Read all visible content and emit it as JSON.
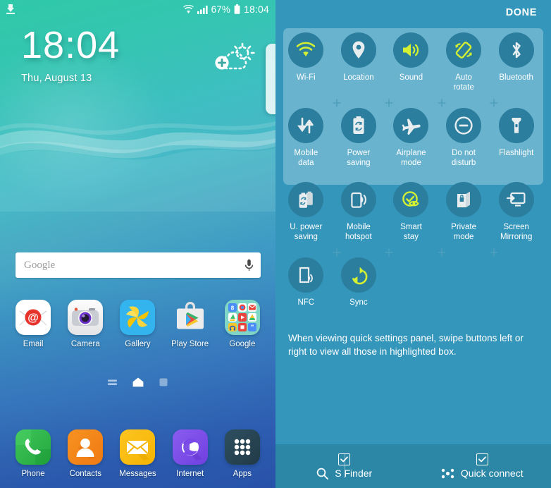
{
  "home": {
    "status_bar": {
      "download_icon": "download-icon",
      "wifi_icon": "wifi-icon",
      "signal_icon": "signal-bars-icon",
      "battery_percent": "67%",
      "battery_icon": "battery-icon",
      "clock": "18:04"
    },
    "clock_widget": {
      "time": "18:04",
      "date": "Thu, August 13",
      "weather_icon": "add-weather-icon"
    },
    "search": {
      "placeholder": "Google",
      "mic_icon": "microphone-icon"
    },
    "apps": [
      {
        "label": "Email",
        "icon": "email-icon"
      },
      {
        "label": "Camera",
        "icon": "camera-icon"
      },
      {
        "label": "Gallery",
        "icon": "gallery-icon"
      },
      {
        "label": "Play Store",
        "icon": "play-store-icon"
      },
      {
        "label": "Google",
        "icon": "google-folder-icon"
      }
    ],
    "page_indicator": [
      {
        "name": "briefing-page-icon",
        "active": false
      },
      {
        "name": "home-page-icon",
        "active": true
      },
      {
        "name": "page-dot-icon",
        "active": false
      }
    ],
    "dock": [
      {
        "label": "Phone",
        "icon": "phone-icon"
      },
      {
        "label": "Contacts",
        "icon": "contacts-icon"
      },
      {
        "label": "Messages",
        "icon": "messages-icon"
      },
      {
        "label": "Internet",
        "icon": "internet-icon"
      },
      {
        "label": "Apps",
        "icon": "apps-grid-icon"
      }
    ]
  },
  "quick_settings": {
    "done_label": "DONE",
    "note": "When viewing quick settings panel, swipe buttons left or right to view all those in highlighted box.",
    "plus_label": "+",
    "rows": [
      {
        "in_highlight": true,
        "buttons": [
          {
            "label": "Wi-Fi",
            "icon": "wifi-icon",
            "active": true
          },
          {
            "label": "Location",
            "icon": "location-pin-icon",
            "active": false
          },
          {
            "label": "Sound",
            "icon": "sound-speaker-icon",
            "active": true
          },
          {
            "label": "Auto\nrotate",
            "icon": "auto-rotate-icon",
            "active": true
          },
          {
            "label": "Bluetooth",
            "icon": "bluetooth-icon",
            "active": false
          }
        ]
      },
      {
        "in_highlight": true,
        "buttons": [
          {
            "label": "Mobile\ndata",
            "icon": "mobile-data-icon",
            "active": false
          },
          {
            "label": "Power\nsaving",
            "icon": "power-saving-icon",
            "active": false
          },
          {
            "label": "Airplane\nmode",
            "icon": "airplane-mode-icon",
            "active": false
          },
          {
            "label": "Do not\ndisturb",
            "icon": "do-not-disturb-icon",
            "active": false
          },
          {
            "label": "Flashlight",
            "icon": "flashlight-icon",
            "active": false
          }
        ]
      },
      {
        "in_highlight": false,
        "buttons": [
          {
            "label": "U. power\nsaving",
            "icon": "ultra-power-saving-icon",
            "active": false
          },
          {
            "label": "Mobile\nhotspot",
            "icon": "mobile-hotspot-icon",
            "active": false
          },
          {
            "label": "Smart\nstay",
            "icon": "smart-stay-icon",
            "active": true
          },
          {
            "label": "Private\nmode",
            "icon": "private-mode-icon",
            "active": false
          },
          {
            "label": "Screen\nMirroring",
            "icon": "screen-mirroring-icon",
            "active": false
          }
        ]
      },
      {
        "in_highlight": false,
        "buttons": [
          {
            "label": "NFC",
            "icon": "nfc-icon",
            "active": false
          },
          {
            "label": "Sync",
            "icon": "sync-icon",
            "active": true
          }
        ]
      }
    ],
    "bottom_bar": [
      {
        "label": "S Finder",
        "icon": "search-icon",
        "checked": true
      },
      {
        "label": "Quick connect",
        "icon": "quick-connect-icon",
        "checked": true
      }
    ]
  },
  "colors": {
    "panel_bg": "#3496bb",
    "highlight_box": "#69b3ce",
    "button_circle": "#2b7e9e",
    "active_icon": "#d4f032",
    "inactive_icon": "#e8eef0",
    "bottom_bar": "#2c87a7"
  }
}
